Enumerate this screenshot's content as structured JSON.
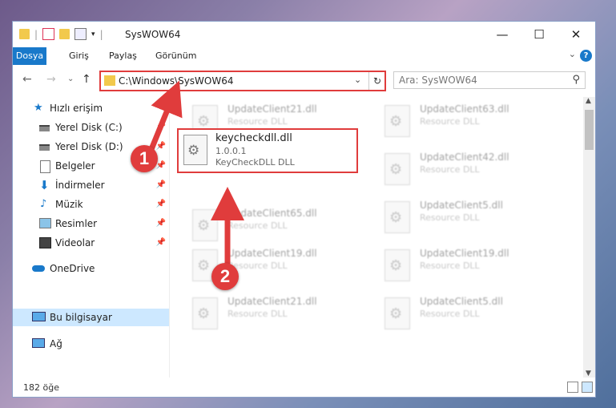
{
  "window": {
    "title": "SysWOW64",
    "minimize": "—",
    "maximize": "☐",
    "close": "✕"
  },
  "ribbon": {
    "tabs": [
      "Dosya",
      "Giriş",
      "Paylaş",
      "Görünüm"
    ],
    "expand": "⌄",
    "help": "?"
  },
  "nav": {
    "back": "←",
    "forward": "→",
    "recent": "⌄",
    "up": "↑",
    "address": "C:\\Windows\\SysWOW64",
    "address_dropdown": "⌄",
    "refresh": "↻",
    "search_placeholder": "Ara: SysWOW64",
    "search_icon": "⚲"
  },
  "sidebar": {
    "items": [
      {
        "label": "Hızlı erişim",
        "icon": "star-icon",
        "pinned": false
      },
      {
        "label": "Yerel Disk (C:)",
        "icon": "drive-icon",
        "pinned": true
      },
      {
        "label": "Yerel Disk (D:)",
        "icon": "drive-icon",
        "pinned": true
      },
      {
        "label": "Belgeler",
        "icon": "document-icon",
        "pinned": true
      },
      {
        "label": "İndirmeler",
        "icon": "download-icon",
        "pinned": true
      },
      {
        "label": "Müzik",
        "icon": "music-icon",
        "pinned": true
      },
      {
        "label": "Resimler",
        "icon": "pictures-icon",
        "pinned": true
      },
      {
        "label": "Videolar",
        "icon": "video-icon",
        "pinned": true
      },
      {
        "label": "OneDrive",
        "icon": "cloud-icon",
        "pinned": false
      },
      {
        "label": "Bu bilgisayar",
        "icon": "computer-icon",
        "pinned": false,
        "selected": true
      },
      {
        "label": "Ağ",
        "icon": "network-icon",
        "pinned": false
      }
    ],
    "pin_glyph": "📌"
  },
  "files": {
    "left": [
      {
        "name": "UpdateClient21.dll",
        "desc": "Resource DLL"
      },
      {
        "name": "UpdateClient65.dll",
        "desc": "Resource DLL"
      },
      {
        "name": "UpdateClient19.dll",
        "desc": "Resource DLL"
      },
      {
        "name": "UpdateClient21.dll",
        "desc": "Resource DLL"
      }
    ],
    "right": [
      {
        "name": "UpdateClient63.dll",
        "desc": "Resource DLL"
      },
      {
        "name": "UpdateClient42.dll",
        "desc": "Resource DLL"
      },
      {
        "name": "UpdateClient5.dll",
        "desc": "Resource DLL"
      },
      {
        "name": "UpdateClient19.dll",
        "desc": "Resource DLL"
      },
      {
        "name": "UpdateClient5.dll",
        "desc": "Resource DLL"
      }
    ],
    "highlighted": {
      "name": "keycheckdll.dll",
      "version": "1.0.0.1",
      "desc": "KeyCheckDLL DLL"
    }
  },
  "status": {
    "count": "182 öğe"
  },
  "annotations": {
    "step1": "1",
    "step2": "2",
    "color": "#e03c3c"
  }
}
